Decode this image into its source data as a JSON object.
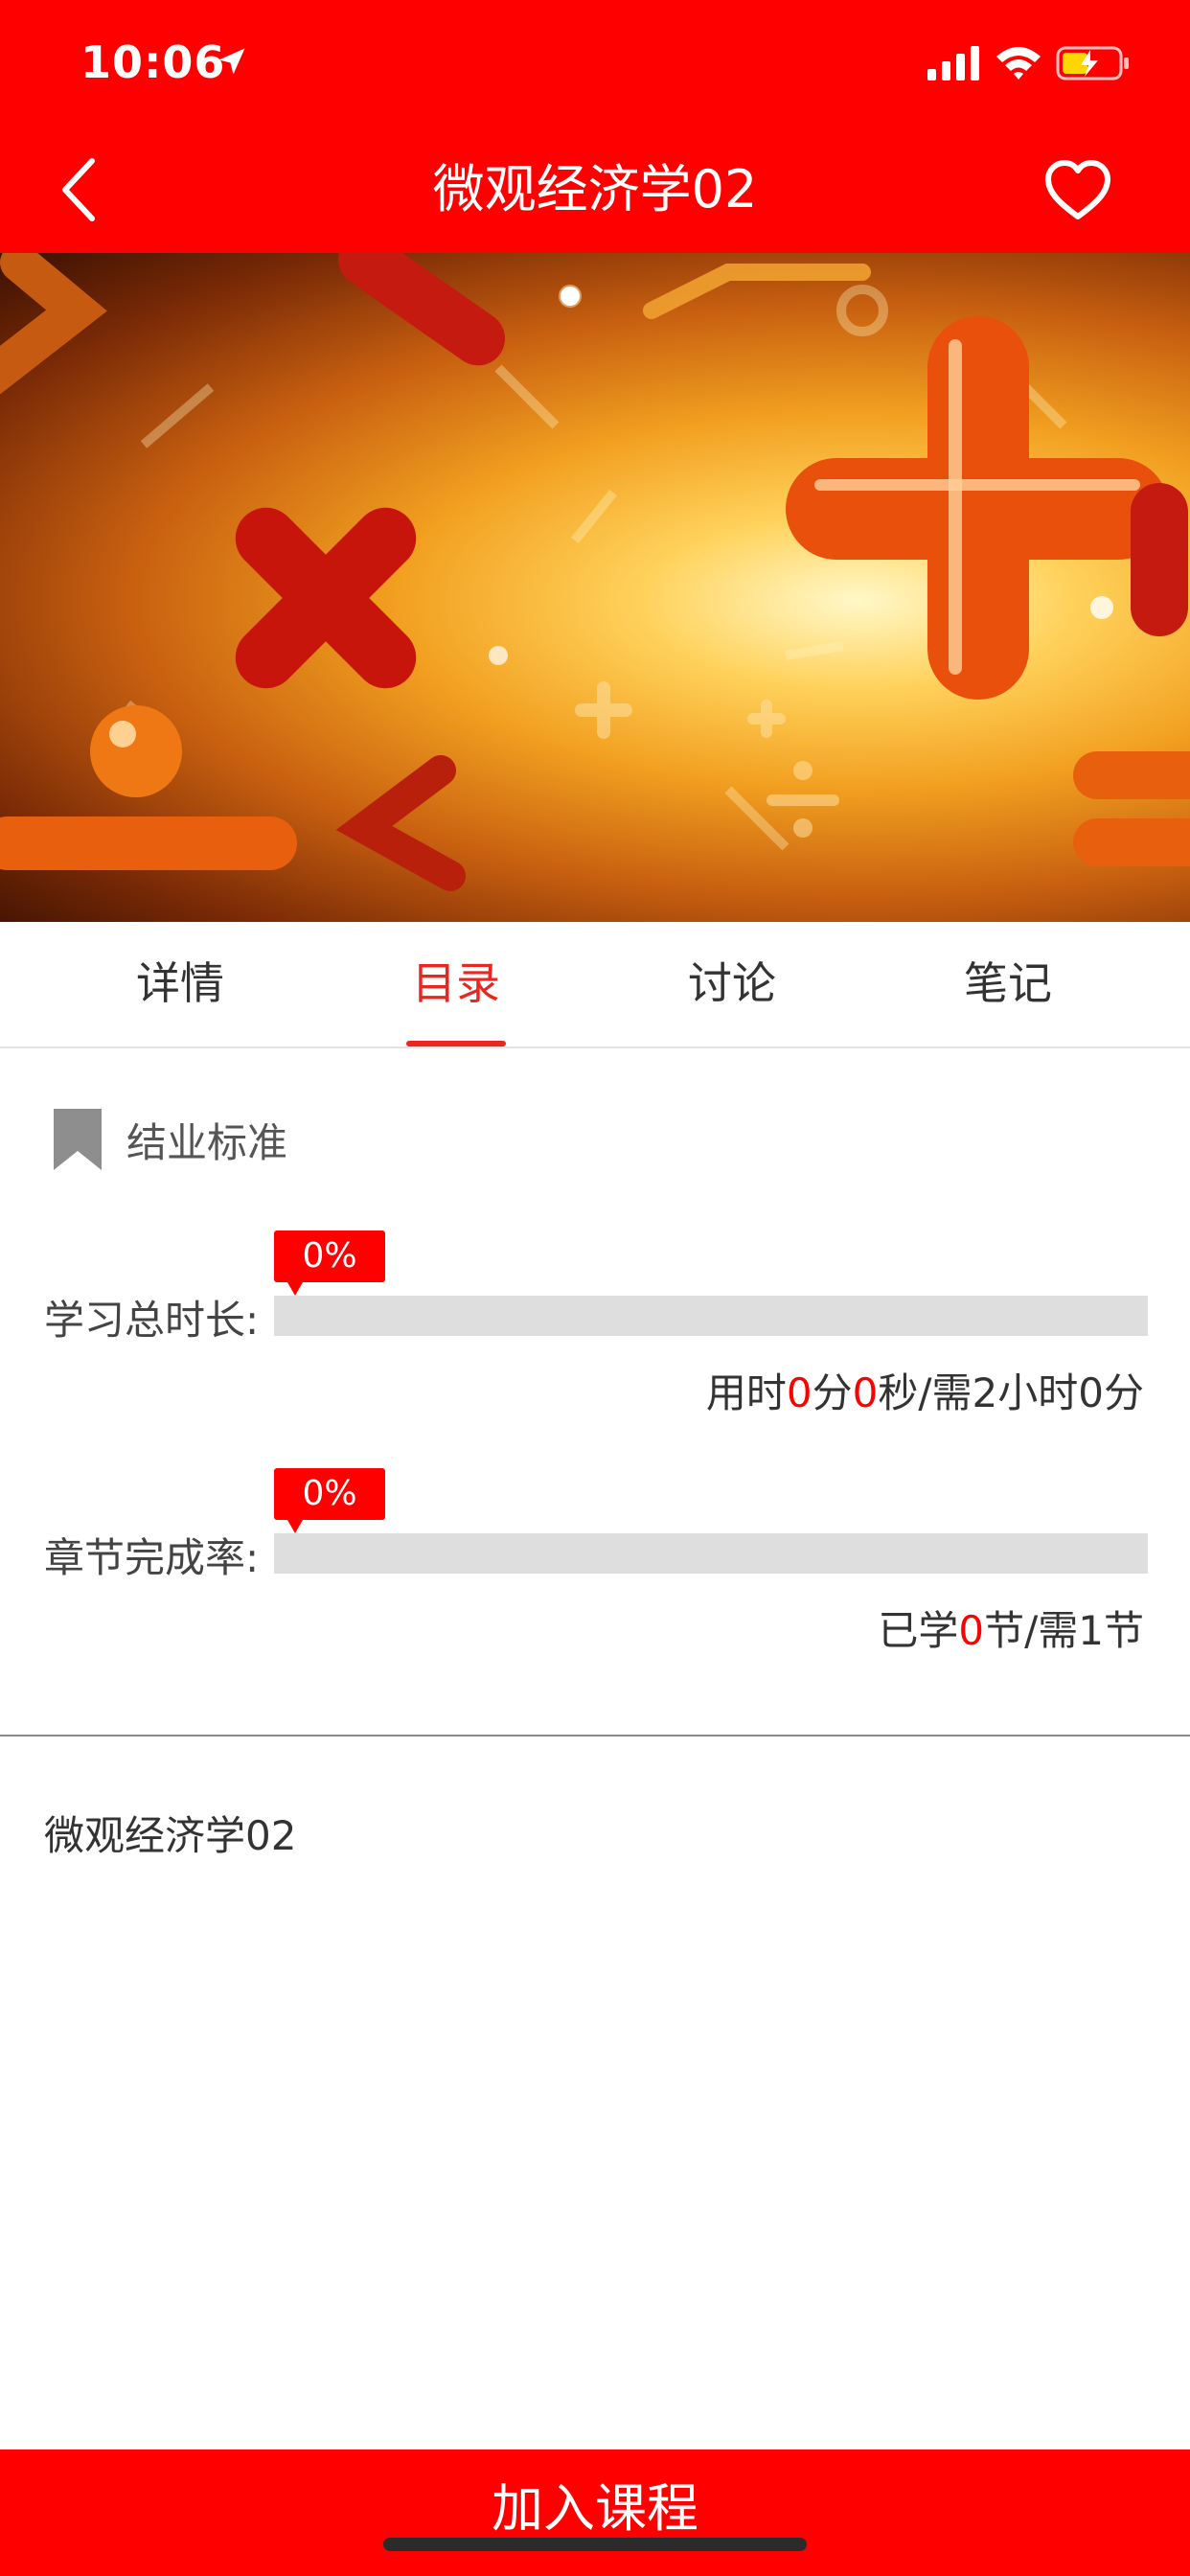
{
  "status_bar": {
    "time": "10:06",
    "icons": [
      "location-arrow-icon",
      "cellular-signal-icon",
      "wifi-icon",
      "battery-charging-icon"
    ]
  },
  "nav": {
    "title": "微观经济学02",
    "back_icon": "chevron-left-icon",
    "favorite_icon": "heart-outline-icon"
  },
  "banner": {
    "image": "math-symbols-banner"
  },
  "tabs": [
    {
      "label": "详情",
      "active": false
    },
    {
      "label": "目录",
      "active": true
    },
    {
      "label": "讨论",
      "active": false
    },
    {
      "label": "笔记",
      "active": false
    }
  ],
  "completion_standard": {
    "title": "结业标准",
    "icon": "bookmark-icon",
    "study_time": {
      "label": "学习总时长:",
      "percent_text": "0%",
      "progress": 0,
      "info_prefix": "用时",
      "minutes": "0",
      "minute_unit": "分",
      "seconds": "0",
      "second_unit": "秒",
      "required": "/需2小时0分"
    },
    "chapter_rate": {
      "label": "章节完成率:",
      "percent_text": "0%",
      "progress": 0,
      "info_prefix": "已学",
      "learned": "0",
      "required": "节/需1节"
    }
  },
  "catalog": {
    "items": [
      "微观经济学02"
    ]
  },
  "footer": {
    "join_label": "加入课程"
  },
  "colors": {
    "primary": "#ff0000",
    "active_tab": "#e8271e",
    "track": "#dedede"
  }
}
